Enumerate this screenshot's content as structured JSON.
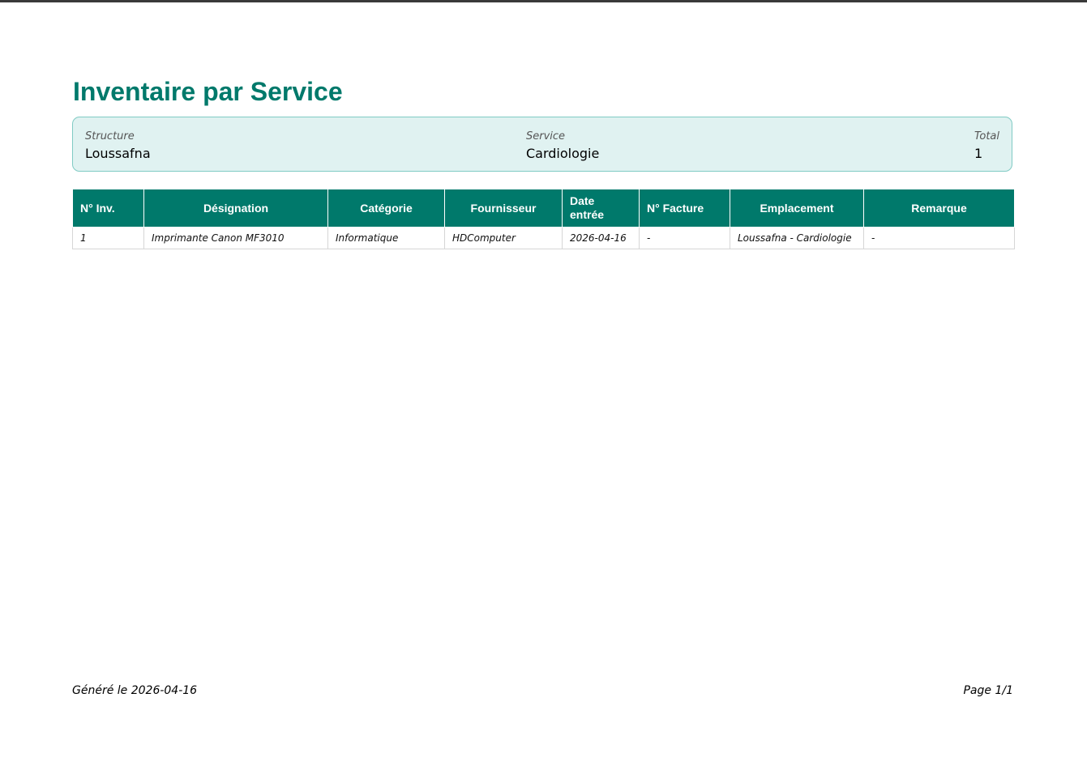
{
  "report": {
    "title": "Inventaire par Service"
  },
  "info": {
    "structure_label": "Structure",
    "structure_value": "Loussafna",
    "service_label": "Service",
    "service_value": "Cardiologie",
    "total_label": "Total",
    "total_value": "1"
  },
  "table": {
    "headers": {
      "inv": "N° Inv.",
      "designation": "Désignation",
      "categorie": "Catégorie",
      "fournisseur": "Fournisseur",
      "date_entree_line1": "Date",
      "date_entree_line2": "entrée",
      "facture": "N° Facture",
      "emplacement": "Emplacement",
      "remarque": "Remarque"
    },
    "rows": [
      {
        "inv": "1",
        "designation": "Imprimante Canon MF3010",
        "categorie": "Informatique",
        "fournisseur": "HDComputer",
        "date_entree": "2026-04-16",
        "facture": "-",
        "emplacement": "Loussafna - Cardiologie",
        "remarque": "-"
      }
    ]
  },
  "footer": {
    "generated": "Généré le 2026-04-16",
    "page": "Page 1/1"
  },
  "colors": {
    "accent": "#00796b",
    "info_background": "#e0f2f1",
    "info_border": "#80cbc4"
  }
}
